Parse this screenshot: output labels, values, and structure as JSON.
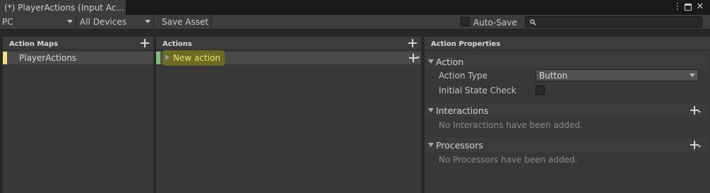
{
  "window": {
    "tab_title": "(*) PlayerActions (Input Ac..."
  },
  "toolbar": {
    "control_scheme": "PC",
    "devices": "All Devices",
    "save_asset": "Save Asset",
    "auto_save": "Auto-Save",
    "search_value": ""
  },
  "action_maps": {
    "header": "Action Maps",
    "items": [
      "PlayerActions"
    ],
    "accent": "#f4e07a"
  },
  "actions": {
    "header": "Actions",
    "items": [
      "New action"
    ],
    "accent": "#7fbf7f",
    "highlight": "#6f6f1e"
  },
  "properties": {
    "header": "Action Properties",
    "action_section": "Action",
    "action_type_label": "Action Type",
    "action_type_value": "Button",
    "initial_state_check_label": "Initial State Check",
    "interactions_section": "Interactions",
    "interactions_empty": "No Interactions have been added.",
    "processors_section": "Processors",
    "processors_empty": "No Processors have been added."
  },
  "icons": [
    "menu-icon",
    "maximize-icon",
    "close-icon",
    "search-icon",
    "add-icon",
    "add-dropdown-icon",
    "collapse-triangle-icon",
    "expand-triangle-icon"
  ]
}
